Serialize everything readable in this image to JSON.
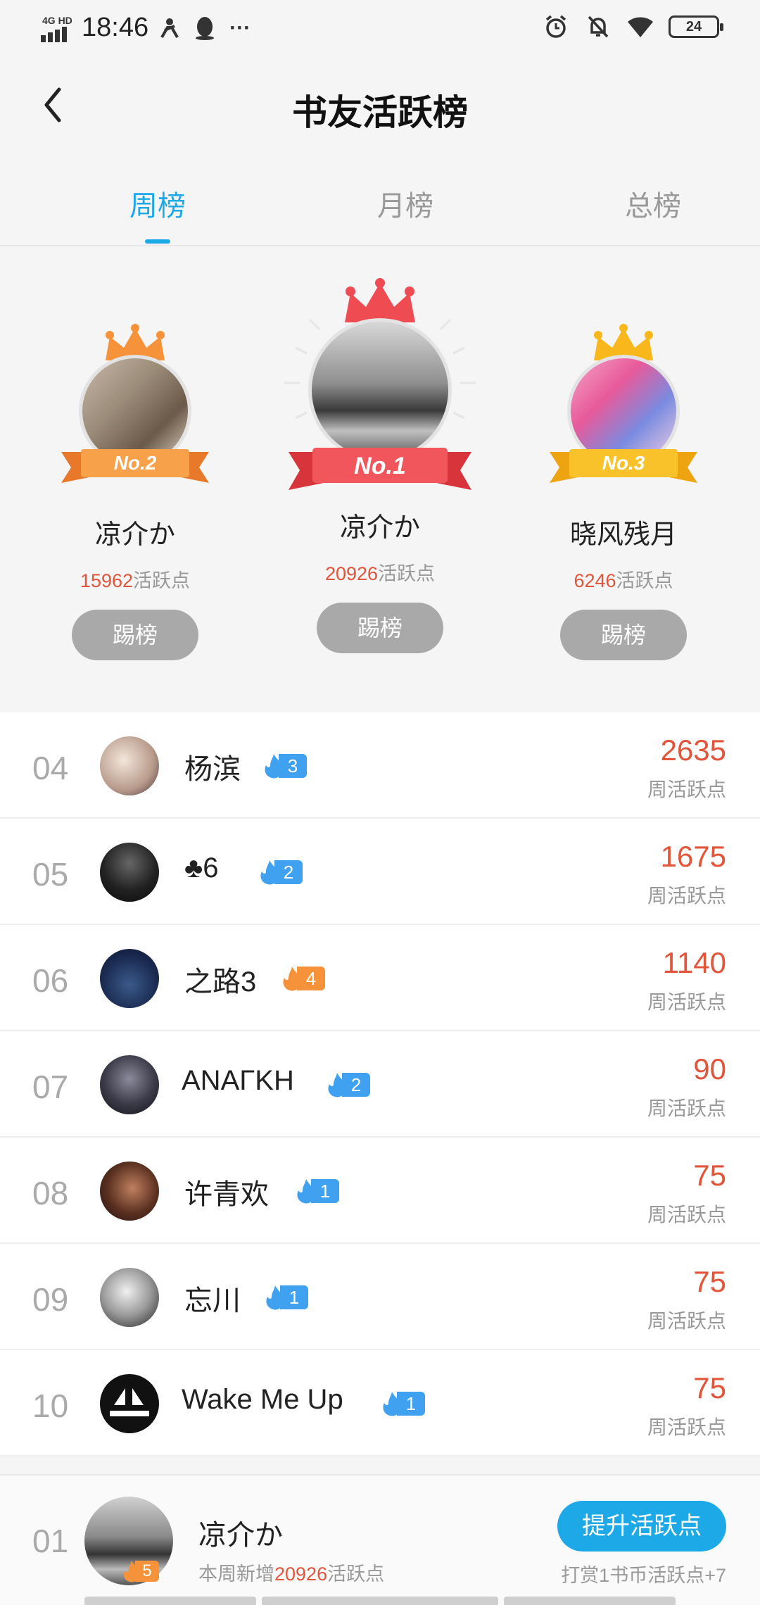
{
  "status_bar": {
    "network": "4G HD",
    "time": "18:46",
    "battery": "24",
    "more": "···"
  },
  "header": {
    "title": "书友活跃榜",
    "back_icon": "chevron-left-icon"
  },
  "tabs": [
    {
      "label": "周榜",
      "active": true
    },
    {
      "label": "月榜",
      "active": false
    },
    {
      "label": "总榜",
      "active": false
    }
  ],
  "podium": [
    {
      "rank_badge": "No.2",
      "name": "凉介か",
      "points": "15962",
      "points_suffix": "活跃点",
      "button": "踢榜",
      "crown_color": "#f5923a"
    },
    {
      "rank_badge": "No.1",
      "name": "凉介か",
      "points": "20926",
      "points_suffix": "活跃点",
      "button": "踢榜",
      "crown_color": "#ef4b52"
    },
    {
      "rank_badge": "No.3",
      "name": "晓风残月",
      "points": "6246",
      "points_suffix": "活跃点",
      "button": "踢榜",
      "crown_color": "#f8b81b"
    }
  ],
  "list": [
    {
      "rank": "04",
      "name": "杨滨",
      "level": "3",
      "badge_color": "blue",
      "score": "2635",
      "score_label": "周活跃点"
    },
    {
      "rank": "05",
      "name": "♣6",
      "level": "2",
      "badge_color": "blue",
      "score": "1675",
      "score_label": "周活跃点"
    },
    {
      "rank": "06",
      "name": "之路3",
      "level": "4",
      "badge_color": "orange",
      "score": "1140",
      "score_label": "周活跃点"
    },
    {
      "rank": "07",
      "name": "ΑΝΑΓΚΗ",
      "level": "2",
      "badge_color": "blue",
      "score": "90",
      "score_label": "周活跃点"
    },
    {
      "rank": "08",
      "name": "许青欢",
      "level": "1",
      "badge_color": "blue",
      "score": "75",
      "score_label": "周活跃点"
    },
    {
      "rank": "09",
      "name": "忘川",
      "level": "1",
      "badge_color": "blue",
      "score": "75",
      "score_label": "周活跃点"
    },
    {
      "rank": "10",
      "name": "Wake Me Up",
      "level": "1",
      "badge_color": "blue",
      "score": "75",
      "score_label": "周活跃点"
    }
  ],
  "my_rank": {
    "rank": "01",
    "name": "凉介か",
    "level": "5",
    "sub_prefix": "本周新增",
    "sub_points": "20926",
    "sub_suffix": "活跃点",
    "button": "提升活跃点",
    "tip": "打赏1书币活跃点+7"
  },
  "colors": {
    "accent": "#1da9e8",
    "points": "#e2553a",
    "kick_button": "#a9a9a9"
  }
}
